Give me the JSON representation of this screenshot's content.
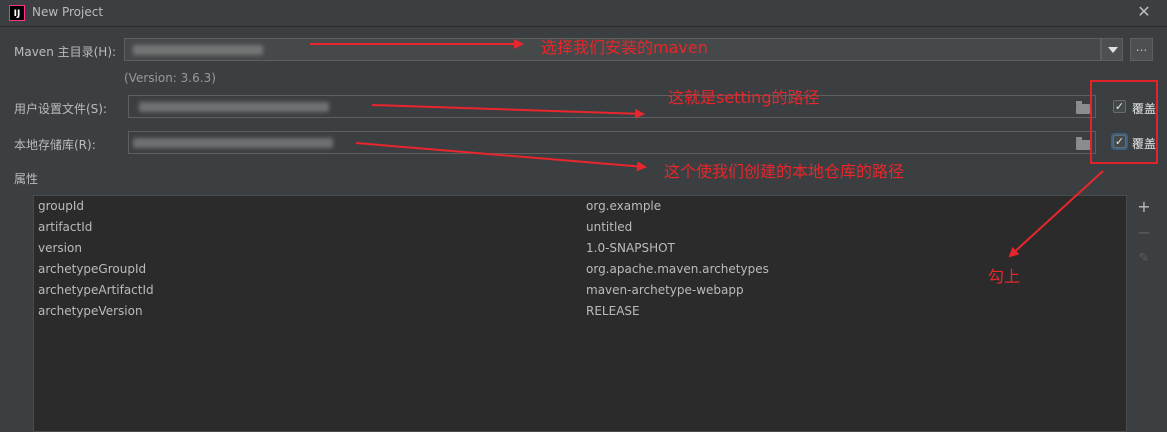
{
  "window": {
    "title": "New Project",
    "app_icon": "IJ"
  },
  "maven_home": {
    "label": "Maven 主目录(H):",
    "version": "(Version: 3.6.3)"
  },
  "user_settings": {
    "label": "用户设置文件(S):",
    "override_label": "覆盖",
    "override_checked": true
  },
  "local_repo": {
    "label": "本地存储库(R):",
    "override_label": "覆盖",
    "override_checked": true
  },
  "properties": {
    "section_label": "属性",
    "rows": [
      {
        "key": "groupId",
        "value": "org.example"
      },
      {
        "key": "artifactId",
        "value": "untitled"
      },
      {
        "key": "version",
        "value": "1.0-SNAPSHOT"
      },
      {
        "key": "archetypeGroupId",
        "value": "org.apache.maven.archetypes"
      },
      {
        "key": "archetypeArtifactId",
        "value": "maven-archetype-webapp"
      },
      {
        "key": "archetypeVersion",
        "value": "RELEASE"
      }
    ]
  },
  "toolbar": {
    "add": "+",
    "remove": "−",
    "edit": "✎"
  },
  "annotations": {
    "maven": "选择我们安装的maven",
    "setting": "这就是setting的路径",
    "repo": "这个使我们创建的本地仓库的路径",
    "check": "勾上",
    "color": "#e8262b"
  },
  "icons": {
    "close": "close-icon",
    "dropdown": "chevron-down-icon",
    "folder": "folder-icon"
  },
  "browse_label": "..."
}
